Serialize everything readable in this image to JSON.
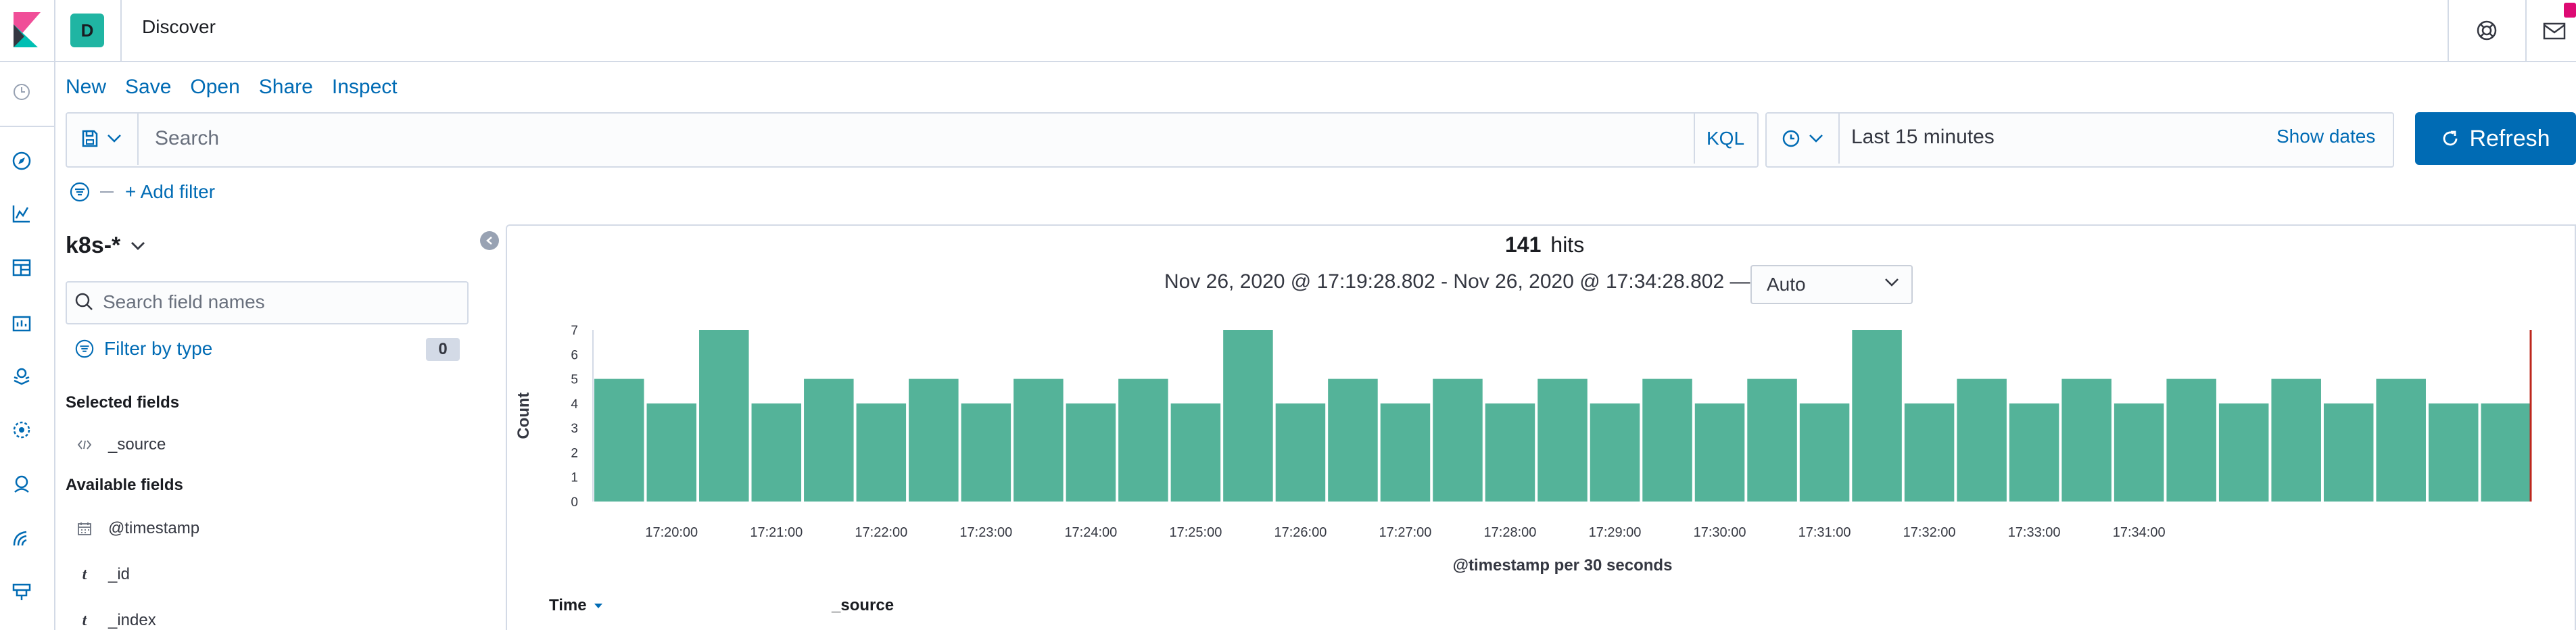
{
  "header": {
    "space_initial": "D",
    "app_title": "Discover",
    "icons": [
      "kibana-logo-icon",
      "help-icon",
      "newsfeed-icon"
    ]
  },
  "nav_rail": {
    "icons": [
      "recently-viewed-icon",
      "discover-icon",
      "visualize-icon",
      "dashboard-icon",
      "canvas-icon",
      "maps-icon",
      "ml-icon",
      "siem-icon",
      "logs-icon",
      "stack-management-icon"
    ]
  },
  "top_nav": {
    "items": [
      "New",
      "Save",
      "Open",
      "Share",
      "Inspect"
    ]
  },
  "query_bar": {
    "placeholder": "Search",
    "language": "KQL",
    "time_range": "Last 15 minutes",
    "show_dates": "Show dates",
    "refresh_label": "Refresh"
  },
  "filters": {
    "add_filter": "+ Add filter"
  },
  "sidebar": {
    "index_pattern": "k8s-*",
    "field_search_placeholder": "Search field names",
    "filter_by_type": "Filter by type",
    "filter_count": "0",
    "selected_title": "Selected fields",
    "selected_fields": [
      {
        "icon": "source",
        "name": "_source"
      }
    ],
    "available_title": "Available fields",
    "available_fields": [
      {
        "icon": "date",
        "name": "@timestamp"
      },
      {
        "icon": "t",
        "name": "_id"
      },
      {
        "icon": "t",
        "name": "_index"
      }
    ]
  },
  "results": {
    "hits_count": "141",
    "hits_label": "hits",
    "time_range_text": "Nov 26, 2020 @ 17:19:28.802 - Nov 26, 2020 @ 17:34:28.802 —",
    "interval": "Auto",
    "table_headers": [
      "Time",
      "_source"
    ]
  },
  "chart_data": {
    "type": "bar",
    "ylabel": "Count",
    "xlabel": "@timestamp per 30 seconds",
    "ylim": [
      0,
      7
    ],
    "yticks": [
      0,
      1,
      2,
      3,
      4,
      5,
      6,
      7
    ],
    "xtick_labels": [
      "17:20:00",
      "17:21:00",
      "17:22:00",
      "17:23:00",
      "17:24:00",
      "17:25:00",
      "17:26:00",
      "17:27:00",
      "17:28:00",
      "17:29:00",
      "17:30:00",
      "17:31:00",
      "17:32:00",
      "17:33:00",
      "17:34:00"
    ],
    "values": [
      5,
      4,
      7,
      4,
      5,
      4,
      5,
      4,
      5,
      4,
      5,
      4,
      7,
      4,
      5,
      4,
      5,
      4,
      5,
      4,
      5,
      4,
      5,
      4,
      7,
      4,
      5,
      4,
      5,
      4,
      5,
      4,
      5,
      4,
      5,
      4,
      4
    ],
    "bar_color": "#54b399",
    "now_marker_color": "#bd271e"
  }
}
